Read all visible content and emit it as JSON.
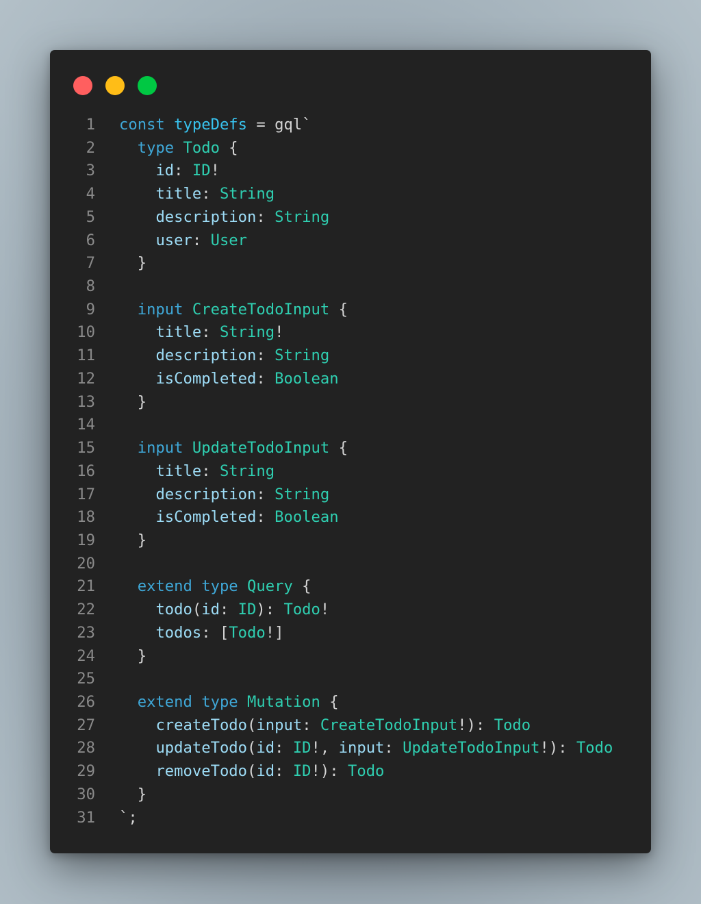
{
  "window": {
    "controls": [
      {
        "name": "close",
        "color": "#ff5f5f"
      },
      {
        "name": "minimize",
        "color": "#ffbd17"
      },
      {
        "name": "maximize",
        "color": "#00c843"
      }
    ]
  },
  "colors": {
    "window_bg": "#222222",
    "line_number": "#8a8a8a",
    "keyword": "#3fa8d8",
    "variable": "#38c3ef",
    "type": "#2fcfb1",
    "field": "#9ddcf6",
    "punctuation": "#d4d4d4"
  },
  "code": {
    "language": "GraphQL (gql template literal)",
    "lines": [
      {
        "n": "1",
        "tokens": [
          [
            "kw",
            "const"
          ],
          [
            "pn",
            " "
          ],
          [
            "var",
            "typeDefs"
          ],
          [
            "pn",
            " = gql`"
          ]
        ]
      },
      {
        "n": "2",
        "tokens": [
          [
            "pn",
            "  "
          ],
          [
            "kw",
            "type"
          ],
          [
            "pn",
            " "
          ],
          [
            "ty",
            "Todo"
          ],
          [
            "pn",
            " {"
          ]
        ]
      },
      {
        "n": "3",
        "tokens": [
          [
            "pn",
            "    "
          ],
          [
            "fld",
            "id"
          ],
          [
            "pn",
            ": "
          ],
          [
            "ty",
            "ID"
          ],
          [
            "pn",
            "!"
          ]
        ]
      },
      {
        "n": "4",
        "tokens": [
          [
            "pn",
            "    "
          ],
          [
            "fld",
            "title"
          ],
          [
            "pn",
            ": "
          ],
          [
            "ty",
            "String"
          ]
        ]
      },
      {
        "n": "5",
        "tokens": [
          [
            "pn",
            "    "
          ],
          [
            "fld",
            "description"
          ],
          [
            "pn",
            ": "
          ],
          [
            "ty",
            "String"
          ]
        ]
      },
      {
        "n": "6",
        "tokens": [
          [
            "pn",
            "    "
          ],
          [
            "fld",
            "user"
          ],
          [
            "pn",
            ": "
          ],
          [
            "ty",
            "User"
          ]
        ]
      },
      {
        "n": "7",
        "tokens": [
          [
            "pn",
            "  }"
          ]
        ]
      },
      {
        "n": "8",
        "tokens": []
      },
      {
        "n": "9",
        "tokens": [
          [
            "pn",
            "  "
          ],
          [
            "kw",
            "input"
          ],
          [
            "pn",
            " "
          ],
          [
            "ty",
            "CreateTodoInput"
          ],
          [
            "pn",
            " {"
          ]
        ]
      },
      {
        "n": "10",
        "tokens": [
          [
            "pn",
            "    "
          ],
          [
            "fld",
            "title"
          ],
          [
            "pn",
            ": "
          ],
          [
            "ty",
            "String"
          ],
          [
            "pn",
            "!"
          ]
        ]
      },
      {
        "n": "11",
        "tokens": [
          [
            "pn",
            "    "
          ],
          [
            "fld",
            "description"
          ],
          [
            "pn",
            ": "
          ],
          [
            "ty",
            "String"
          ]
        ]
      },
      {
        "n": "12",
        "tokens": [
          [
            "pn",
            "    "
          ],
          [
            "fld",
            "isCompleted"
          ],
          [
            "pn",
            ": "
          ],
          [
            "ty",
            "Boolean"
          ]
        ]
      },
      {
        "n": "13",
        "tokens": [
          [
            "pn",
            "  }"
          ]
        ]
      },
      {
        "n": "14",
        "tokens": []
      },
      {
        "n": "15",
        "tokens": [
          [
            "pn",
            "  "
          ],
          [
            "kw",
            "input"
          ],
          [
            "pn",
            " "
          ],
          [
            "ty",
            "UpdateTodoInput"
          ],
          [
            "pn",
            " {"
          ]
        ]
      },
      {
        "n": "16",
        "tokens": [
          [
            "pn",
            "    "
          ],
          [
            "fld",
            "title"
          ],
          [
            "pn",
            ": "
          ],
          [
            "ty",
            "String"
          ]
        ]
      },
      {
        "n": "17",
        "tokens": [
          [
            "pn",
            "    "
          ],
          [
            "fld",
            "description"
          ],
          [
            "pn",
            ": "
          ],
          [
            "ty",
            "String"
          ]
        ]
      },
      {
        "n": "18",
        "tokens": [
          [
            "pn",
            "    "
          ],
          [
            "fld",
            "isCompleted"
          ],
          [
            "pn",
            ": "
          ],
          [
            "ty",
            "Boolean"
          ]
        ]
      },
      {
        "n": "19",
        "tokens": [
          [
            "pn",
            "  }"
          ]
        ]
      },
      {
        "n": "20",
        "tokens": []
      },
      {
        "n": "21",
        "tokens": [
          [
            "pn",
            "  "
          ],
          [
            "kw",
            "extend"
          ],
          [
            "pn",
            " "
          ],
          [
            "kw",
            "type"
          ],
          [
            "pn",
            " "
          ],
          [
            "ty",
            "Query"
          ],
          [
            "pn",
            " {"
          ]
        ]
      },
      {
        "n": "22",
        "tokens": [
          [
            "pn",
            "    "
          ],
          [
            "fld",
            "todo"
          ],
          [
            "pn",
            "("
          ],
          [
            "fld",
            "id"
          ],
          [
            "pn",
            ": "
          ],
          [
            "ty",
            "ID"
          ],
          [
            "pn",
            "): "
          ],
          [
            "ty",
            "Todo"
          ],
          [
            "pn",
            "!"
          ]
        ]
      },
      {
        "n": "23",
        "tokens": [
          [
            "pn",
            "    "
          ],
          [
            "fld",
            "todos"
          ],
          [
            "pn",
            ": ["
          ],
          [
            "ty",
            "Todo"
          ],
          [
            "pn",
            "!]"
          ]
        ]
      },
      {
        "n": "24",
        "tokens": [
          [
            "pn",
            "  }"
          ]
        ]
      },
      {
        "n": "25",
        "tokens": []
      },
      {
        "n": "26",
        "tokens": [
          [
            "pn",
            "  "
          ],
          [
            "kw",
            "extend"
          ],
          [
            "pn",
            " "
          ],
          [
            "kw",
            "type"
          ],
          [
            "pn",
            " "
          ],
          [
            "ty",
            "Mutation"
          ],
          [
            "pn",
            " {"
          ]
        ]
      },
      {
        "n": "27",
        "tokens": [
          [
            "pn",
            "    "
          ],
          [
            "fld",
            "createTodo"
          ],
          [
            "pn",
            "("
          ],
          [
            "fld",
            "input"
          ],
          [
            "pn",
            ": "
          ],
          [
            "ty",
            "CreateTodoInput"
          ],
          [
            "pn",
            "!): "
          ],
          [
            "ty",
            "Todo"
          ]
        ]
      },
      {
        "n": "28",
        "tokens": [
          [
            "pn",
            "    "
          ],
          [
            "fld",
            "updateTodo"
          ],
          [
            "pn",
            "("
          ],
          [
            "fld",
            "id"
          ],
          [
            "pn",
            ": "
          ],
          [
            "ty",
            "ID"
          ],
          [
            "pn",
            "!, "
          ],
          [
            "fld",
            "input"
          ],
          [
            "pn",
            ": "
          ],
          [
            "ty",
            "UpdateTodoInput"
          ],
          [
            "pn",
            "!): "
          ],
          [
            "ty",
            "Todo"
          ]
        ]
      },
      {
        "n": "29",
        "tokens": [
          [
            "pn",
            "    "
          ],
          [
            "fld",
            "removeTodo"
          ],
          [
            "pn",
            "("
          ],
          [
            "fld",
            "id"
          ],
          [
            "pn",
            ": "
          ],
          [
            "ty",
            "ID"
          ],
          [
            "pn",
            "!): "
          ],
          [
            "ty",
            "Todo"
          ]
        ]
      },
      {
        "n": "30",
        "tokens": [
          [
            "pn",
            "  }"
          ]
        ]
      },
      {
        "n": "31",
        "tokens": [
          [
            "pn",
            "`;"
          ]
        ]
      }
    ]
  }
}
